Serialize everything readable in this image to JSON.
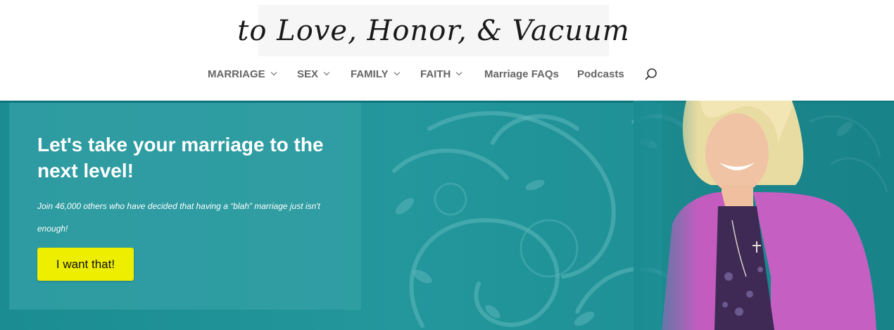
{
  "site": {
    "logo_text": "to Love, Honor, & Vacuum"
  },
  "nav": {
    "items": [
      {
        "label": "MARRIAGE",
        "has_dropdown": true
      },
      {
        "label": "SEX",
        "has_dropdown": true
      },
      {
        "label": "FAMILY",
        "has_dropdown": true
      },
      {
        "label": "FAITH",
        "has_dropdown": true
      },
      {
        "label": "Marriage FAQs",
        "has_dropdown": false
      },
      {
        "label": "Podcasts",
        "has_dropdown": false
      }
    ],
    "search_icon": "search-icon"
  },
  "hero": {
    "title": "Let's take your marriage to the next level!",
    "subtitle": "Join 46,000 others who have decided that having a “blah” marriage just isn't enough!",
    "cta_label": "I want that!"
  },
  "colors": {
    "teal": "#1d8e94",
    "cta": "#eeee00",
    "nav_text": "#666666",
    "jacket": "#c45cc0"
  }
}
